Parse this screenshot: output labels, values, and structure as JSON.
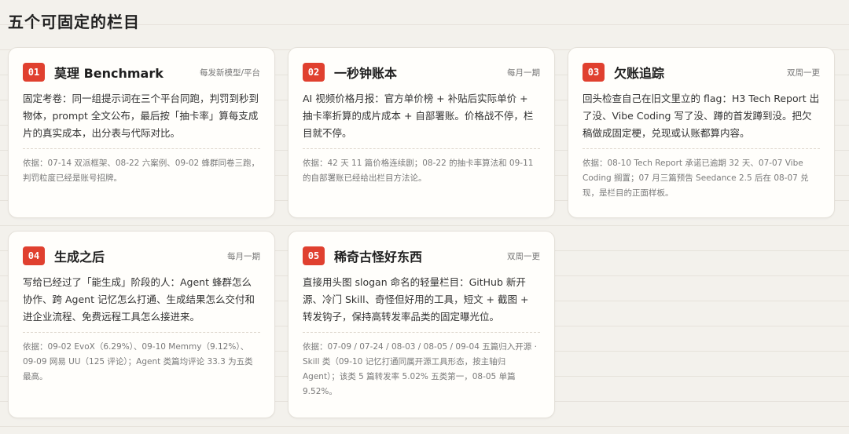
{
  "page_title": "五个可固定的栏目",
  "colors": {
    "accent": "#e0402f",
    "background": "#f3f1ec",
    "card": "#fffefb"
  },
  "cards": [
    {
      "num": "01",
      "title": "莫理 Benchmark",
      "freq": "每发新模型/平台",
      "desc": "固定考卷：同一组提示词在三个平台同跑，判罚到秒到物体，prompt 全文公布，最后按「抽卡率」算每支成片的真实成本，出分表与代际对比。",
      "basis": "依据：07-14 双派框架、08-22 六案例、09-02 蜂群同卷三跑，判罚粒度已经是账号招牌。"
    },
    {
      "num": "02",
      "title": "一秒钟账本",
      "freq": "每月一期",
      "desc": "AI 视频价格月报：官方单价榜 + 补贴后实际单价 + 抽卡率折算的成片成本 + 自部署账。价格战不停，栏目就不停。",
      "basis": "依据：42 天 11 篇价格连续剧；08-22 的抽卡率算法和 09-11 的自部署账已经给出栏目方法论。"
    },
    {
      "num": "03",
      "title": "欠账追踪",
      "freq": "双周一更",
      "desc": "回头检查自己在旧文里立的 flag：H3 Tech Report 出了没、Vibe Coding 写了没、蹲的首发蹲到没。把欠稿做成固定梗，兑现或认账都算内容。",
      "basis": "依据：08-10 Tech Report 承诺已逾期 32 天、07-07 Vibe Coding 搁置；07 月三篇预告 Seedance 2.5 后在 08-07 兑现，是栏目的正面样板。"
    },
    {
      "num": "04",
      "title": "生成之后",
      "freq": "每月一期",
      "desc": "写给已经过了「能生成」阶段的人：Agent 蜂群怎么协作、跨 Agent 记忆怎么打通、生成结果怎么交付和进企业流程、免费远程工具怎么接进来。",
      "basis": "依据：09-02 EvoX（6.29%）、09-10 Memmy（9.12%）、09-09 网易 UU（125 评论）；Agent 类篇均评论 33.3 为五类最高。"
    },
    {
      "num": "05",
      "title": "稀奇古怪好东西",
      "freq": "双周一更",
      "desc": "直接用头图 slogan 命名的轻量栏目：GitHub 新开源、冷门 Skill、奇怪但好用的工具，短文 + 截图 + 转发钩子，保持高转发率品类的固定曝光位。",
      "basis": "依据：07-09 / 07-24 / 08-03 / 08-05 / 09-04 五篇归入开源 · Skill 类（09-10 记忆打通同属开源工具形态，按主轴归 Agent）；该类 5 篇转发率 5.02% 五类第一，08-05 单篇 9.52%。"
    }
  ]
}
